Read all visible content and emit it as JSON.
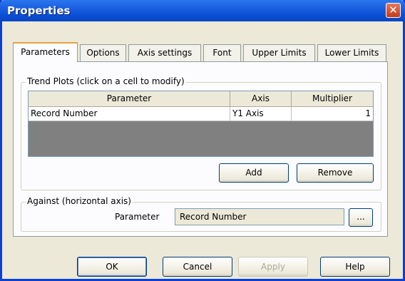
{
  "window": {
    "title": "Properties",
    "close_label": "✕"
  },
  "tabs": [
    {
      "label": "Parameters",
      "active": true
    },
    {
      "label": "Options"
    },
    {
      "label": "Axis settings"
    },
    {
      "label": "Font"
    },
    {
      "label": "Upper Limits"
    },
    {
      "label": "Lower Limits"
    }
  ],
  "trend_plots": {
    "group_label": "Trend Plots (click on a cell to modify)",
    "columns": [
      "Parameter",
      "Axis",
      "Multiplier"
    ],
    "rows": [
      {
        "parameter": "Record Number",
        "axis": "Y1 Axis",
        "multiplier": "1"
      }
    ],
    "add_label": "Add",
    "remove_label": "Remove"
  },
  "against": {
    "group_label": "Against (horizontal axis)",
    "parameter_label": "Parameter",
    "parameter_value": "Record Number",
    "browse_label": "..."
  },
  "footer": {
    "ok_label": "OK",
    "cancel_label": "Cancel",
    "apply_label": "Apply",
    "help_label": "Help"
  }
}
